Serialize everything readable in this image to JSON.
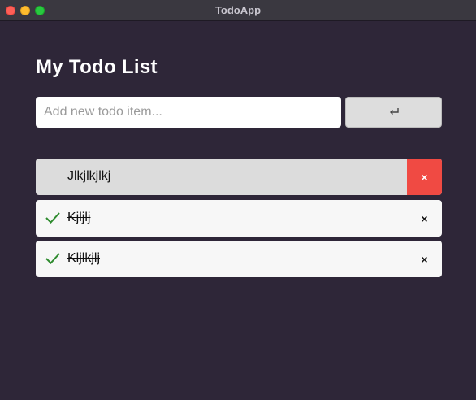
{
  "window": {
    "title": "TodoApp"
  },
  "header": {
    "title": "My Todo List"
  },
  "new_todo": {
    "placeholder": "Add new todo item...",
    "value": "",
    "submit_label": "↩"
  },
  "todos": [
    {
      "text": "Jlkjlkjlkj",
      "done": false,
      "delete_label": "×"
    },
    {
      "text": "Kjljlj",
      "done": true,
      "delete_label": "×"
    },
    {
      "text": "Kljlkjlj",
      "done": true,
      "delete_label": "×"
    }
  ],
  "colors": {
    "background": "#2e2638",
    "delete_hover": "#f04a43",
    "check": "#2e8b2e"
  }
}
